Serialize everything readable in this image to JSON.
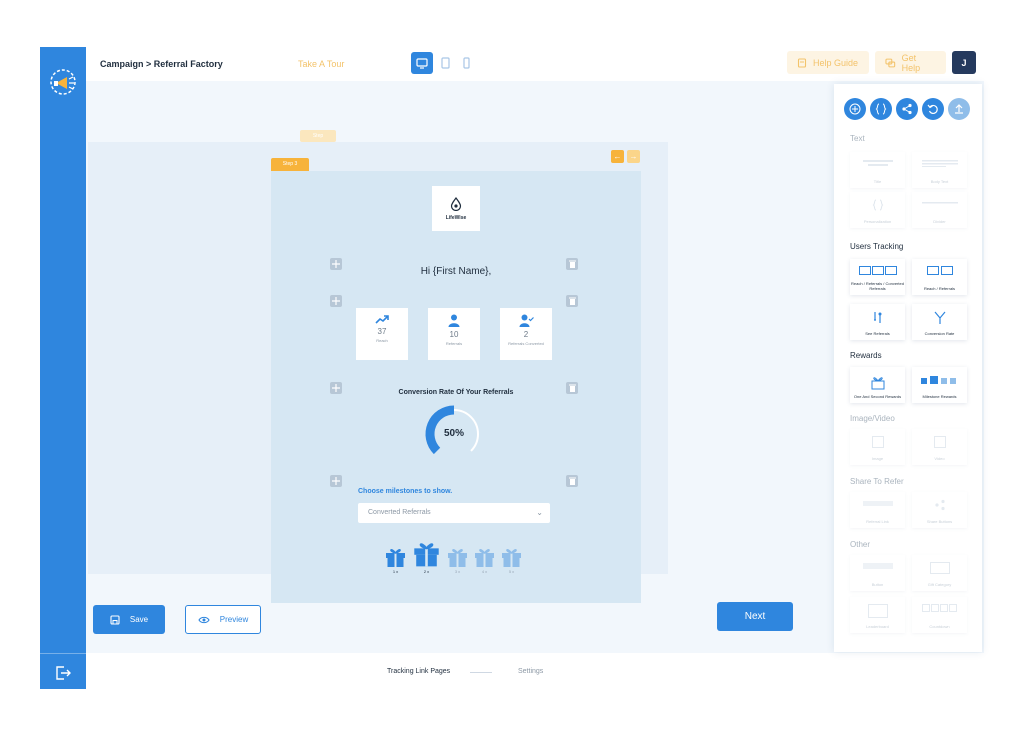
{
  "header": {
    "breadcrumb": "Campaign > Referral Factory",
    "tour_label": "Take A Tour",
    "help_guide_label": "Help Guide",
    "get_help_label": "Get Help",
    "avatar_initial": "J"
  },
  "editor": {
    "ghost_step_label": "Step",
    "step_label": "Step 3",
    "brand_name": "LifeWise",
    "greeting": "Hi {First Name},",
    "stats": [
      {
        "value": "37",
        "label": "Reach"
      },
      {
        "value": "10",
        "label": "Referrals"
      },
      {
        "value": "2",
        "label": "Referrals Converted"
      }
    ],
    "conversion_title": "Conversion Rate Of Your Referrals",
    "conversion_percent": "50%",
    "conversion_fraction": 0.5,
    "milestones_title": "Choose milestones to show.",
    "milestones_selected": "Converted Referrals",
    "gifts": [
      {
        "label": "1 x"
      },
      {
        "label": "2 x"
      },
      {
        "label": "3 x"
      },
      {
        "label": "4 x"
      },
      {
        "label": "5 x"
      }
    ]
  },
  "actions": {
    "save_label": "Save",
    "preview_label": "Preview",
    "next_label": "Next"
  },
  "footer_steps": {
    "step1": "Tracking Link Pages",
    "step2": "Settings"
  },
  "panel": {
    "sections": {
      "text": "Text",
      "users_tracking": "Users Tracking",
      "rewards": "Rewards",
      "image_video": "Image/Video",
      "share": "Share To Refer",
      "other": "Other"
    },
    "tiles": {
      "title": "Title",
      "body_text": "Body Text",
      "personalization": "Personalization",
      "divider": "Divider",
      "reach_referrals_converted": "Reach / Referrals / Converted Referrals",
      "reach_referrals": "Reach / Referrals",
      "see_referrals": "See Referrals",
      "conversion_rate": "Conversion Rate",
      "one_and_second_rewards": "One And Second Rewards",
      "milestone_rewards": "Milestone Rewards",
      "image": "Image",
      "video": "Video",
      "referral_link": "Referral Link",
      "share_buttons": "Share Buttons",
      "button": "Button",
      "gift_category": "Gift Category",
      "leaderboard": "Leaderboard",
      "countdown": "Countdown"
    }
  },
  "colors": {
    "primary": "#2f86de",
    "accent": "#f7b33b",
    "dark": "#253a5e"
  }
}
